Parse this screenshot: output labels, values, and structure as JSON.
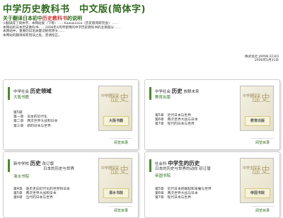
{
  "header": {
    "title": "中学历史教科书　中文版(简体字)"
  },
  "subtitle": {
    "prefix": "关于翻译日本初中",
    "highlight": "历史教科书",
    "suffix": "的说明"
  },
  "intro": {
    "p1": "①翻译成了简体字。本网站受（下称）……Kawakuisia（历史教育研究会）……",
    "p2": "本网站的日本历史教科书……2006年4月所使用的中学历史教科书的主要部分……",
    "p3": "本网站中，重要的日语关键词附有原文……",
    "p4": "本网站的翻译如有错误之处，恳请指正。"
  },
  "signature": {
    "org": "株式会社 JAPAN ECHO",
    "date": "2006年5月31日"
  },
  "cards": [
    {
      "line1_small": "中学社会",
      "line1_big": "历史领域",
      "publisher": "大阪书籍",
      "part": "第5部",
      "toc": [
        "第一章　日本的近代化",
        "第二章　两次世界大战和日本",
        "第三章　新的日本与世界"
      ],
      "book_kanji": "歴史",
      "book_label": "中学歷",
      "book_pub": "大阪书籍",
      "read": "阅览目录"
    },
    {
      "line1_small": "中学社会",
      "line1_big": "历史",
      "line1_extra": "放眼未来",
      "publisher": "教育出版",
      "part": "",
      "toc": [
        "第5章　近代日本与世界",
        "第6章　两次世界大战与日本",
        "第7章　现代的日本与世界"
      ],
      "book_kanji": "歴史",
      "book_label": "中学歷",
      "book_pub": "教育出版",
      "read": "阅览目录"
    },
    {
      "line1_small": "新中学校",
      "line1_big": "历史",
      "line1_extra": "改订版",
      "line1_sub": "日本的历史与世界",
      "publisher": "清水书院",
      "part": "",
      "toc": [
        "第4章　逐步走向近代化的世界和日本",
        "第5章　两次世界大战和日本",
        "第6章　当代的日本与世界"
      ],
      "book_kanji": "歴史",
      "book_label": "中学歷",
      "book_pub": "清水书院",
      "read": "阅览目录"
    },
    {
      "line1_small": "社会科",
      "line1_big": "中学生的历史",
      "line1_sub": "日本的历史与世界的动向 初订版",
      "publisher": "帝国书院",
      "part": "",
      "toc": [
        "第5章　近代日本的崛起和发展与世界",
        "第6章　两次世界大战与日本",
        "第7章　现代日本与世界"
      ],
      "book_kanji": "歴史",
      "book_label": "中学生",
      "book_pub": "帝国书院",
      "read": "阅览目录"
    }
  ],
  "colors": {
    "accent": "#2f6a1f",
    "bar": "#4a8a2a"
  }
}
